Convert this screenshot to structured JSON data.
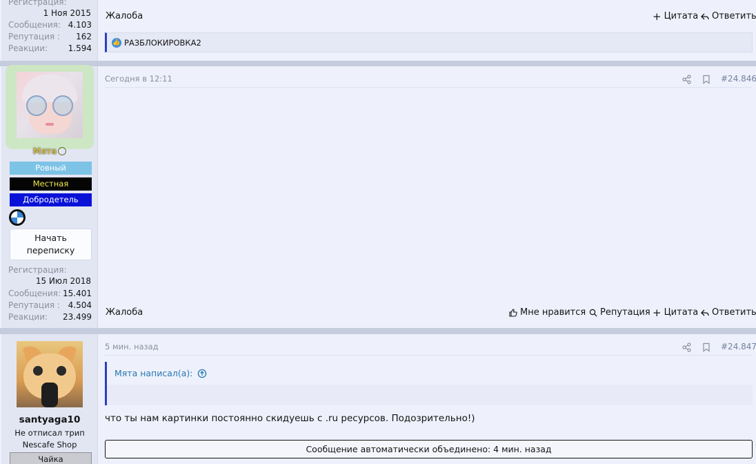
{
  "post1": {
    "registration_label": "Регистрация:",
    "registration_date": "1 Ноя 2015",
    "stats": [
      {
        "label": "Сообщения:",
        "value": "4.103"
      },
      {
        "label": "Репутация :",
        "value": "162"
      },
      {
        "label": "Реакции:",
        "value": "1.594"
      }
    ],
    "report": "Жалоба",
    "quote": "Цитата",
    "reply": "Ответить",
    "reaction_text": "РАЗБЛОКИРОВКА2"
  },
  "post2": {
    "username": "Мята",
    "badges": [
      {
        "label": "Ровный",
        "bg": "#7cc3e6",
        "color": "#ffffff"
      },
      {
        "label": "Местная",
        "bg": "#050505",
        "color": "#f2e64a"
      },
      {
        "label": "Добродетель",
        "bg": "#0a12d8",
        "color": "#ffffff"
      }
    ],
    "start_conversation": "Начать переписку",
    "registration_label": "Регистрация:",
    "registration_date": "15 Июл 2018",
    "stats": [
      {
        "label": "Сообщения:",
        "value": "15.401"
      },
      {
        "label": "Репутация :",
        "value": "4.504"
      },
      {
        "label": "Реакции:",
        "value": "23.499"
      }
    ],
    "time": "Сегодня в 12:11",
    "post_number": "#24.846",
    "report": "Жалоба",
    "like": "Мне нравится",
    "reputation": "Репутация",
    "quote": "Цитата",
    "reply": "Ответить"
  },
  "post3": {
    "username": "santyaga10",
    "user_title": "Не отписал трип",
    "shop": "Nescafe Shop",
    "badge": "Чайка",
    "time": "5 мин. назад",
    "post_number": "#24.847",
    "quote_author": "Мята написал(а):",
    "message": "что ты нам картинки постоянно скидуешь с .ru ресурсов. Подозрительно!)",
    "merged_notice": "Сообщение автоматически объединено: 4 мин. назад"
  },
  "colors": {
    "accent": "#2577b1",
    "quote_border": "#2b3ec4",
    "username_gold": "#c9b64a"
  }
}
